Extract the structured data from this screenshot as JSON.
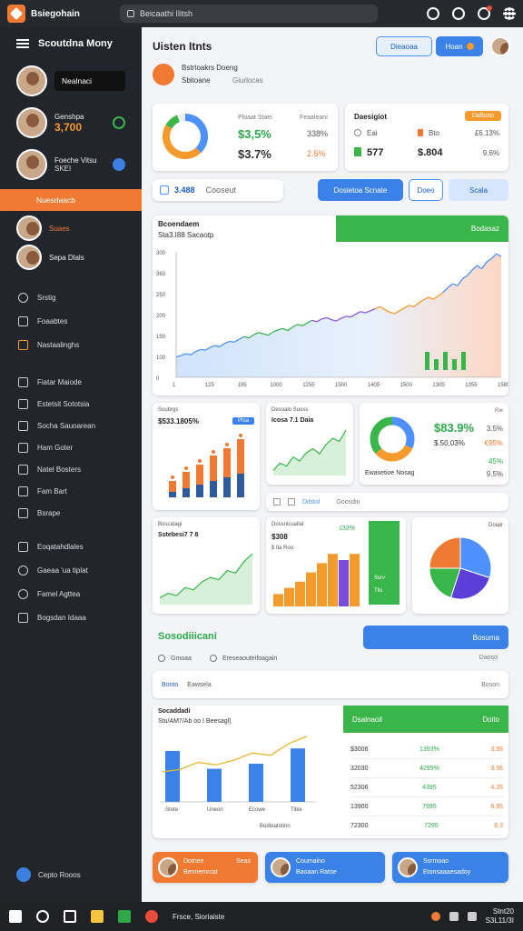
{
  "titlebar": {
    "app_name": "Bsiegohain",
    "url": "Beicaathi Ilitsh"
  },
  "sidebar": {
    "title": "Scoutdna Mony",
    "contacts": [
      {
        "pill": "Nealnaci"
      },
      {
        "name": "Genshpa",
        "value": "3,700"
      },
      {
        "name": "Foeche Vitsu",
        "sub": "SKEI"
      },
      {
        "name": "Nuesdaacb"
      },
      {
        "name": "Suaes"
      },
      {
        "name": "Sepa Dlals"
      }
    ],
    "nav_a": [
      "Srstig",
      "Foaabtes",
      "Nastaalinghs"
    ],
    "nav_b": [
      "Fiatar Maiode",
      "Estetsit Sototsia",
      "Socha Sauoarean",
      "Ham Goter",
      "Natel Bosters",
      "Fam Bart",
      "Bsrape"
    ],
    "nav_c": [
      "Eoqatahdlales",
      "Gaeaa 'ua tiplat",
      "Famel Agttea",
      "Bogsdan Idaaa"
    ],
    "footer": "Cepto Rooos"
  },
  "header": {
    "title": "Uisten Itnts",
    "btn_a": "Dieaoaa",
    "btn_b": "Hoan",
    "sub_a": "Bstrtoakrs Doeng",
    "sub_b": "Sbitoane",
    "sub_c": "Giurlocas"
  },
  "kpi": {
    "card1": {
      "label_a": "Ploaat Staei",
      "label_b": "Feaaleani",
      "v1": "$3,5%",
      "v2": "$3.7%",
      "p1": "338%",
      "p2": "2.5%"
    },
    "card2": {
      "title": "Daesigiot",
      "badge": "Dalboto",
      "r1a": "Eai",
      "r1b": "Bto",
      "r1c": "£6.13%",
      "r2a": "577",
      "r2b": "$.804",
      "r2c": "9.6%"
    }
  },
  "toolbar": {
    "chip_value": "3.488",
    "chip_label": "Cooseut",
    "btn1": "Dosietoa Scnate",
    "btn2": "Doeo",
    "btn3": "Scala"
  },
  "main_chart": {
    "title": "Bcoendaem",
    "subtitle": "Sta3.I88 Sacaotp",
    "banner": "Bodasaz",
    "yticks": [
      "300",
      "360",
      "250",
      "200",
      "150",
      "100",
      "0"
    ],
    "xticks": [
      "1",
      "125",
      "195",
      "1000",
      "1255",
      "1500",
      "1405",
      "1500",
      "1305",
      "1355",
      "1580"
    ]
  },
  "mini1": {
    "title": "Soubrgs",
    "value": "$533.1805%",
    "tag": "Ptsa"
  },
  "mini2": {
    "title": "Desoalo Suoss",
    "value": "Icosa 7.1 Daia"
  },
  "donut_card": {
    "big": "$83.9%",
    "small": "$.50,03%",
    "p1": "3.5%",
    "p2": "€95%",
    "p3": "45%",
    "p4": "9.5%",
    "caption": "Ewasetioe Nosag",
    "tag": "Rie"
  },
  "filter": {
    "label_a": "Ditstol",
    "label_b": "Goosdio"
  },
  "mini3": {
    "title": "Boscatagi",
    "value": "Sstebesi7 7 8"
  },
  "mini4": {
    "title": "Dossnicuallal",
    "value": "$308",
    "sub": "$ tla Roo",
    "pct": "133%"
  },
  "green_bar": {
    "a": "Ssrv",
    "b": "Tlls"
  },
  "pie_card": {
    "label": "Doiatr"
  },
  "section": {
    "title": "Sosodiiicani",
    "btn": "Bosuma",
    "r1a": "Gmoaa",
    "r1b": "Ereseaouteifoagain",
    "r1c": "Daoso",
    "r2a": "Bonto",
    "r2b": "Eawsela",
    "r2c": "Boson"
  },
  "combo": {
    "title": "Socaddadi",
    "subtitle": "Stu/AM7/Ab oo I Beesagl)",
    "xlabels": [
      "Stote",
      "Uneon",
      "Ecowe",
      "Tibie"
    ],
    "caption": "Budteatotinn"
  },
  "table": {
    "head_a": "Dsalnaoil",
    "head_b": "Doito",
    "rows": [
      [
        "$3006",
        "1393%",
        "3.95"
      ],
      [
        "32030",
        "4295%",
        "3.56"
      ],
      [
        "52306",
        "4395",
        "4.35"
      ],
      [
        "13900",
        "7995",
        "6.95"
      ],
      [
        "72300",
        "7295",
        "6.3"
      ]
    ]
  },
  "people": [
    {
      "name": "Dotnee",
      "sub": "Bennemrcat",
      "tag": "Seas"
    },
    {
      "name": "Coumaino",
      "sub": "Baoaan Ratoe"
    },
    {
      "name": "Ssrmoao",
      "sub": "Etonsaaaesadoy"
    }
  ],
  "taskbar": {
    "app": "Frsce, Sioriaiste",
    "time": "Stnt20",
    "date": "S3L11/3I"
  },
  "chart_data": [
    {
      "type": "line",
      "title": "Bcoendaem",
      "yticks": [
        "300",
        "360",
        "250",
        "200",
        "150",
        "100",
        "0"
      ],
      "values": [
        30,
        32,
        35,
        33,
        38,
        41,
        40,
        44,
        47,
        45,
        50,
        53,
        52,
        56,
        60,
        58,
        63,
        66,
        64,
        62,
        67,
        70,
        72,
        69,
        74,
        78,
        76,
        80,
        84,
        82,
        86,
        88,
        85,
        83,
        87,
        90,
        89,
        93,
        97,
        95,
        98,
        101,
        104,
        100,
        96,
        94,
        98,
        102,
        106,
        104,
        110,
        114,
        118,
        115,
        120,
        125,
        132,
        138,
        135,
        145,
        150,
        158,
        165,
        160,
        170,
        175,
        182,
        178
      ]
    },
    {
      "type": "bar",
      "title": "Soubrgs",
      "categories": [
        "a",
        "b",
        "c",
        "d",
        "e",
        "f"
      ],
      "series": [
        {
          "values": [
            12,
            18,
            22,
            28,
            32,
            38
          ]
        },
        {
          "values": [
            6,
            10,
            14,
            18,
            22,
            26
          ]
        }
      ]
    },
    {
      "type": "area",
      "title": "Desoalo Suoss",
      "values": [
        5,
        12,
        9,
        18,
        14,
        22,
        26,
        21,
        30,
        36,
        33,
        44
      ]
    },
    {
      "type": "area",
      "title": "Boscatagi",
      "values": [
        6,
        10,
        8,
        15,
        13,
        20,
        24,
        22,
        30,
        28,
        38,
        45
      ]
    },
    {
      "type": "bar",
      "title": "Dossnicuallal",
      "values": [
        8,
        12,
        16,
        22,
        28,
        34,
        30,
        34
      ]
    },
    {
      "type": "pie",
      "values": [
        30,
        25,
        20,
        25
      ],
      "colors": [
        "#4d90fe",
        "#5b3fd6",
        "#3ab54a",
        "#f07a32"
      ]
    },
    {
      "type": "bar",
      "title": "Socaddadi",
      "categories": [
        "Stote",
        "Uneon",
        "Ecowe",
        "Tibie"
      ],
      "values": [
        40,
        26,
        30,
        42
      ],
      "line": [
        10,
        12,
        18,
        16,
        20,
        26,
        24,
        34,
        40
      ]
    }
  ]
}
